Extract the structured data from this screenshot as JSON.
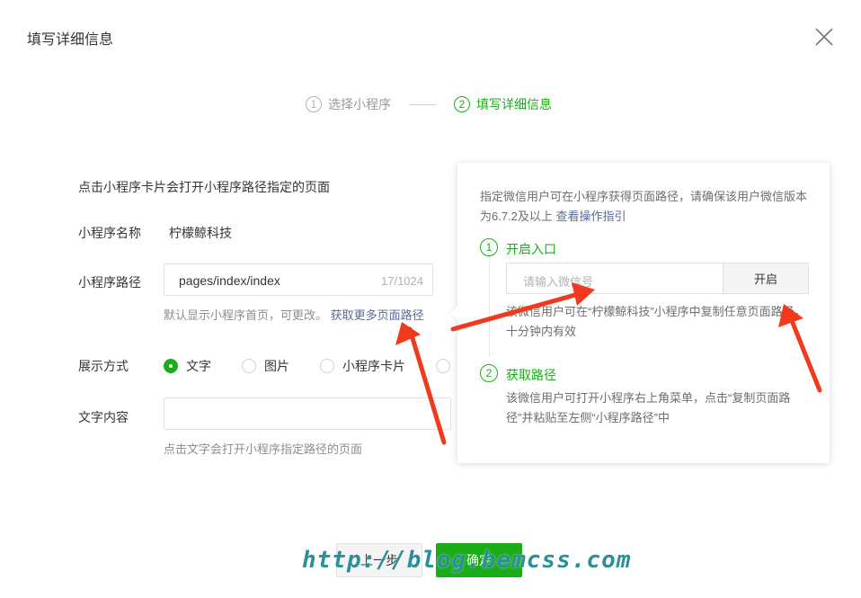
{
  "dialog": {
    "title": "填写详细信息"
  },
  "steps": [
    {
      "num": "1",
      "label": "选择小程序"
    },
    {
      "num": "2",
      "label": "填写详细信息"
    }
  ],
  "form": {
    "description": "点击小程序卡片会打开小程序路径指定的页面",
    "name_label": "小程序名称",
    "name_value": "柠檬鲸科技",
    "path_label": "小程序路径",
    "path_value": "pages/index/index",
    "path_count": "17/1024",
    "path_hint": "默认显示小程序首页，可更改。",
    "path_hint_link": "获取更多页面路径",
    "display_label": "展示方式",
    "display_options": [
      "文字",
      "图片",
      "小程序卡片"
    ],
    "text_label": "文字内容",
    "text_value": "",
    "text_hint": "点击文字会打开小程序指定路径的页面"
  },
  "popover": {
    "intro": "指定微信用户可在小程序获得页面路径，请确保该用户微信版本为6.7.2及以上",
    "intro_link": "查看操作指引",
    "step1_num": "1",
    "step1_title": "开启入口",
    "wechat_placeholder": "请输入微信号",
    "open_button": "开启",
    "step1_text": "该微信用户可在“柠檬鲸科技”小程序中复制任意页面路径，十分钟内有效",
    "step2_num": "2",
    "step2_title": "获取路径",
    "step2_text": "该微信用户可打开小程序右上角菜单，点击“复制页面路径”并粘贴至左侧“小程序路径”中"
  },
  "footer": {
    "cancel": "上一步",
    "confirm": "确定"
  },
  "watermark": "http://blog.bemcss.com",
  "colors": {
    "accent": "#1aad19",
    "link": "#576b95",
    "arrow": "#f03a1e"
  }
}
